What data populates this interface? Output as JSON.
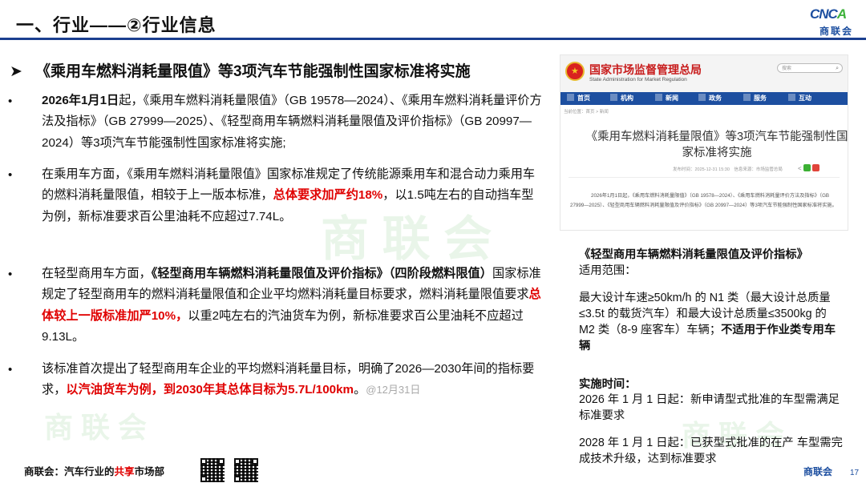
{
  "header": {
    "title": "一、行业——②行业信息",
    "logo": {
      "mark_blue": "CNC",
      "mark_green": "A",
      "sub": "商联会"
    },
    "accent_color": "#1b3f8f"
  },
  "main": {
    "heading_arrow": "➤",
    "heading": "《乘用车燃料消耗量限值》等3项汽车节能强制性国家标准将实施",
    "bullet": "•",
    "p1": {
      "bold_start": "2026年1月1日",
      "text": "起，《乘用车燃料消耗量限值》（GB 19578—2024）、《乘用车燃料消耗量评价方法及指标》（GB 27999—2025）、《轻型商用车辆燃料消耗量限值及评价指标》（GB 20997—2024）等3项汽车节能强制性国家标准将实施;"
    },
    "p2": {
      "text_a": "在乘用车方面，《乘用车燃料消耗量限值》国家标准规定了传统能源乘用车和混合动力乘用车的燃料消耗量限值，相较于上一版本标准，",
      "red": "总体要求加严约18%",
      "text_b": "，以1.5吨左右的自动挡车型为例，新标准要求百公里油耗不应超过7.74L。"
    },
    "p3": {
      "text_a": "在轻型商用车方面，",
      "bold": "《轻型商用车辆燃料消耗量限值及评价指标》（四阶段燃料限值）",
      "text_b": "国家标准规定了轻型商用车的燃料消耗量限值和企业平均燃料消耗量目标要求，燃料消耗量限值要求",
      "red": "总体较上一版标准加严10%，",
      "text_c": "以重2吨左右的汽油货车为例，新标准要求百公里油耗不应超过9.13L。"
    },
    "p4": {
      "text_a": "该标准首次提出了轻型商用车企业的平均燃料消耗量目标，明确了2026—2030年间的指标要求，",
      "red": "以汽油货车为例，到2030年其总体目标为5.7L/100km",
      "text_b": "。",
      "gray": "@12月31日"
    }
  },
  "screenshot": {
    "org_cn": "国家市场监督管理总局",
    "org_en": "State Administration for Market Regulation",
    "search_placeholder": "搜索",
    "nav": [
      "首页",
      "机构",
      "新闻",
      "政务",
      "服务",
      "互动"
    ],
    "breadcrumb": "当前位置：首页 > 新闻",
    "article_title": "《乘用车燃料消耗量限值》等3项汽车节能强制性国家标准将实施",
    "meta": "发布时间：2025-12-31 15:30　信息来源：市场监管总局",
    "body": "2026年1月1日起，《乘用车燃料消耗量限值》（GB 19578—2024）、《乘用车燃料消耗量评价方法及指标》（GB 27999—2025）、《轻型商用车辆燃料消耗量限值及评价指标》（GB 20997—2024）等3项汽车节能强制性国家标准将实施。"
  },
  "right": {
    "standard_title": "《轻型商用车辆燃料消耗量限值及评价指标》",
    "scope_label": "适用范围：",
    "scope_text": "最大设计车速≥50km/h 的 N1 类（最大设计总质量≤3.5t 的载货汽车）和最大设计总质量≤3500kg 的 M2 类（8-9 座客车）车辆；",
    "scope_bold": "不适用于作业类专用车辆",
    "time_label": "实施时间：",
    "time_1": "2026 年 1 月 1 日起：新申请型式批准的车型需满足标准要求",
    "time_2": "2028 年 1 月 1 日起：已获型式批准的在产 车型需完成技术升级，达到标准要求"
  },
  "footer": {
    "prefix": "商联会：汽车行业的",
    "red": "共享",
    "suffix": "市场部",
    "brand": "商联会",
    "page": "17"
  },
  "watermark": "商 联 会"
}
